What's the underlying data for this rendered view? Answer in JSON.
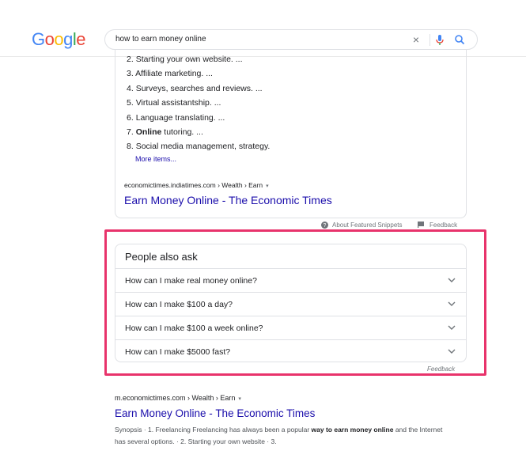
{
  "header": {
    "logo_letters": [
      {
        "ch": "G",
        "color": "#4285f4"
      },
      {
        "ch": "o",
        "color": "#ea4335"
      },
      {
        "ch": "o",
        "color": "#fbbc05"
      },
      {
        "ch": "g",
        "color": "#4285f4"
      },
      {
        "ch": "l",
        "color": "#34a853"
      },
      {
        "ch": "e",
        "color": "#ea4335"
      }
    ],
    "search_query": "how to earn money online",
    "clear_glyph": "×"
  },
  "snippet": {
    "list_items": [
      {
        "num": "2. ",
        "pre": "Starting your own website. ...",
        "bold": "",
        "post": ""
      },
      {
        "num": "3. ",
        "pre": "Affiliate marketing. ...",
        "bold": "",
        "post": ""
      },
      {
        "num": "4. ",
        "pre": "Surveys, searches and reviews. ...",
        "bold": "",
        "post": ""
      },
      {
        "num": "5. ",
        "pre": "Virtual assistantship. ...",
        "bold": "",
        "post": ""
      },
      {
        "num": "6. ",
        "pre": "Language translating. ...",
        "bold": "",
        "post": ""
      },
      {
        "num": "7. ",
        "pre": "",
        "bold": "Online",
        "post": " tutoring. ..."
      },
      {
        "num": "8. ",
        "pre": "Social media management, strategy.",
        "bold": "",
        "post": ""
      }
    ],
    "more_items": "More items...",
    "cite": "economictimes.indiatimes.com › Wealth › Earn",
    "caret": "▾",
    "title": "Earn Money Online - The Economic Times",
    "about_label": "About Featured Snippets",
    "feedback_label": "Feedback"
  },
  "paa": {
    "title": "People also ask",
    "questions": [
      "How can I make real money online?",
      "How can I make $100 a day?",
      "How can I make $100 a week online?",
      "How can I make $5000 fast?"
    ],
    "feedback": "Feedback"
  },
  "result2": {
    "cite": "m.economictimes.com › Wealth › Earn",
    "caret": "▾",
    "title": "Earn Money Online - The Economic Times",
    "snippet_pre": "Synopsis · 1. Freelancing Freelancing has always been a popular ",
    "snippet_bold": "way to earn money online",
    "snippet_post": " and the Internet has several options. · 2. Starting your own website · 3."
  },
  "colors": {
    "link": "#1a0dab",
    "highlight_border": "#e8336b"
  }
}
